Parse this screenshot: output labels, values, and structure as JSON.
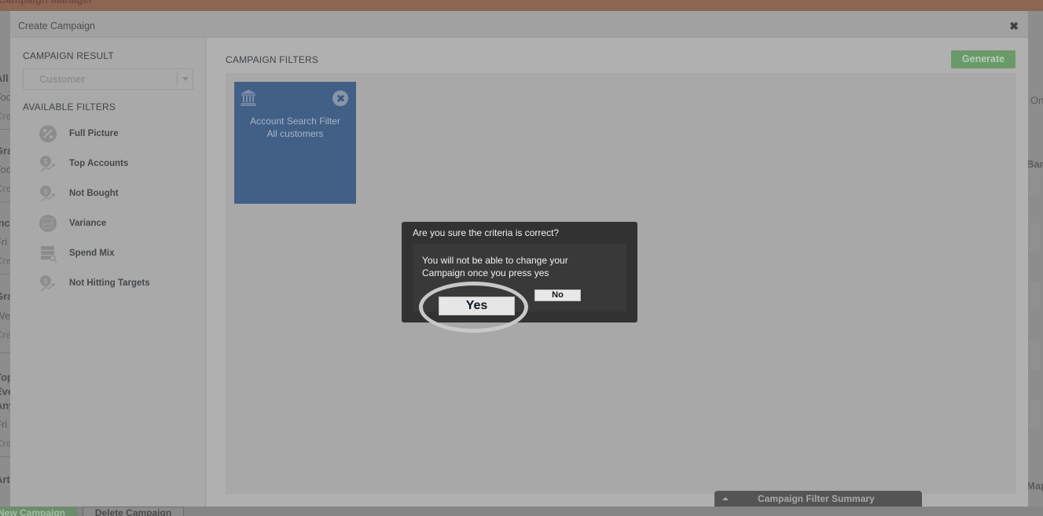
{
  "app": {
    "title": "Campaign Manager"
  },
  "background": {
    "left_fragments": [
      {
        "text": "All p",
        "style": "b"
      },
      {
        "text": "Toda",
        "style": "n"
      },
      {
        "text": "Crea",
        "style": "l"
      },
      {
        "text": "Gra",
        "style": "b"
      },
      {
        "text": "Toda",
        "style": "n"
      },
      {
        "text": "Crea",
        "style": "l"
      },
      {
        "text": "Inc",
        "style": "b"
      },
      {
        "text": "Fri J",
        "style": "n"
      },
      {
        "text": "Crea",
        "style": "l"
      },
      {
        "text": "Gra",
        "style": "b"
      },
      {
        "text": "Wed",
        "style": "n"
      },
      {
        "text": "Crea",
        "style": "l"
      },
      {
        "text": "Top",
        "style": "b"
      },
      {
        "text": "Ever",
        "style": "b"
      },
      {
        "text": "Anyo",
        "style": "b"
      },
      {
        "text": "Fri C",
        "style": "n"
      },
      {
        "text": "Crea",
        "style": "l"
      },
      {
        "text": "Art",
        "style": "b"
      }
    ],
    "right_fragments": [
      "On",
      "Banc",
      "Map"
    ],
    "bottom_buttons": {
      "new_campaign": "New Campaign",
      "delete_campaign": "Delete Campaign"
    }
  },
  "modal": {
    "title": "Create Campaign",
    "close_icon": "close-icon",
    "left_panel": {
      "result_label": "CAMPAIGN RESULT",
      "result_select": {
        "value": "Customer"
      },
      "available_label": "AVAILABLE FILTERS",
      "filters": [
        {
          "label": "Full Picture",
          "icon": "percent-circle-icon"
        },
        {
          "label": "Top Accounts",
          "icon": "dollar-trend-icon"
        },
        {
          "label": "Not Bought",
          "icon": "dollar-trend-icon"
        },
        {
          "label": "Variance",
          "icon": "area-chart-circle-icon"
        },
        {
          "label": "Spend Mix",
          "icon": "table-search-icon"
        },
        {
          "label": "Not Hitting Targets",
          "icon": "dollar-trend-icon"
        }
      ]
    },
    "right_panel": {
      "title": "CAMPAIGN FILTERS",
      "generate_label": "Generate",
      "cards": [
        {
          "icon": "bank-icon",
          "name": "Account Search Filter",
          "detail": "All customers"
        }
      ]
    },
    "summary_tab": {
      "label": "Campaign Filter Summary"
    }
  },
  "dialog": {
    "title": "Are you sure the criteria is correct?",
    "message": "You will not be able to change your Campaign once you press yes",
    "yes_label": "Yes",
    "no_label": "No"
  },
  "colors": {
    "card_blue": "#425f86",
    "generate_green": "#6a9a6a",
    "dialog_bg": "#323232",
    "topbar": "#8c6553"
  }
}
